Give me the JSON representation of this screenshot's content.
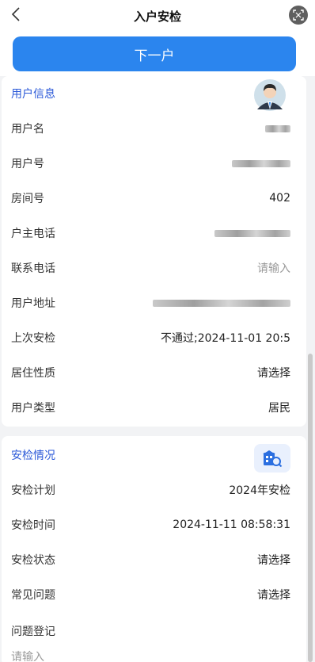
{
  "nav": {
    "title": "入户安检",
    "back_icon": "chevron-left-icon",
    "scan_icon": "scan-icon"
  },
  "next_button": {
    "label": "下一户"
  },
  "user_info": {
    "title": "用户信息",
    "rows": [
      {
        "label": "用户名",
        "value": "",
        "blurred": true
      },
      {
        "label": "用户号",
        "value": "",
        "blurred": true
      },
      {
        "label": "房间号",
        "value": "402"
      },
      {
        "label": "户主电话",
        "value": "",
        "blurred": true
      },
      {
        "label": "联系电话",
        "value": "请输入",
        "placeholder": true
      },
      {
        "label": "用户地址",
        "value": "",
        "blurred": true
      },
      {
        "label": "上次安检",
        "value": "不通过;2024-11-01 20:5"
      },
      {
        "label": "居住性质",
        "value": "请选择"
      },
      {
        "label": "用户类型",
        "value": "居民"
      }
    ]
  },
  "inspection": {
    "title": "安检情况",
    "rows": [
      {
        "label": "安检计划",
        "value": "2024年安检"
      },
      {
        "label": "安检时间",
        "value": "2024-11-11 08:58:31"
      },
      {
        "label": "安检状态",
        "value": "请选择"
      },
      {
        "label": "常见问题",
        "value": "请选择"
      },
      {
        "label": "问题登记",
        "value": ""
      }
    ],
    "problem_input_placeholder": "请输入"
  },
  "colors": {
    "accent": "#2b85ee",
    "section_title": "#2b59d8"
  }
}
